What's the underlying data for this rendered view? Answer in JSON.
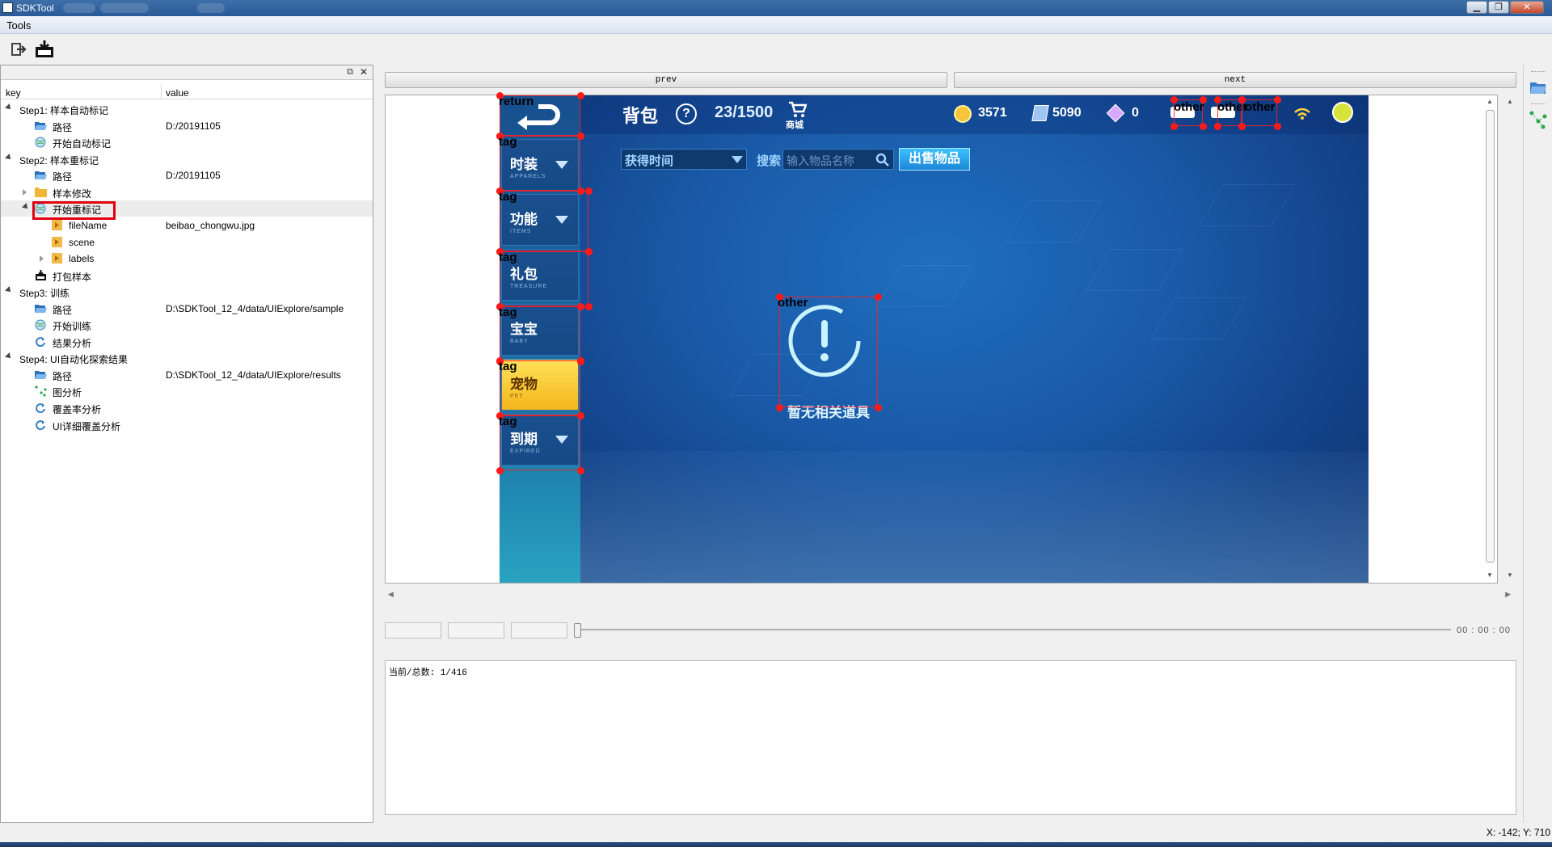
{
  "window": {
    "title": "SDKTool"
  },
  "menu": {
    "tools": "Tools"
  },
  "toolbar": {
    "icons": [
      "exit-icon",
      "save-icon"
    ]
  },
  "tree": {
    "header": {
      "key": "key",
      "value": "value"
    },
    "rows": [
      {
        "label": "Step1: 样本自动标记",
        "value": "",
        "icon": "",
        "expand": "open"
      },
      {
        "label": "路径",
        "value": "D:/20191105",
        "icon": "folder-open-icon",
        "expand": ""
      },
      {
        "label": "开始自动标记",
        "value": "",
        "icon": "globe-icon",
        "expand": ""
      },
      {
        "label": "Step2: 样本重标记",
        "value": "",
        "icon": "",
        "expand": "open"
      },
      {
        "label": "路径",
        "value": "D:/20191105",
        "icon": "folder-open-icon",
        "expand": ""
      },
      {
        "label": "样本修改",
        "value": "",
        "icon": "folder-icon",
        "expand": "closed"
      },
      {
        "label": "开始重标记",
        "value": "",
        "icon": "globe-icon",
        "expand": "open"
      },
      {
        "label": "fileName",
        "value": "beibao_chongwu.jpg",
        "icon": "play-icon",
        "expand": ""
      },
      {
        "label": "scene",
        "value": "",
        "icon": "play-icon",
        "expand": ""
      },
      {
        "label": "labels",
        "value": "",
        "icon": "play-icon",
        "expand": "closed"
      },
      {
        "label": "打包样本",
        "value": "",
        "icon": "package-icon",
        "expand": ""
      },
      {
        "label": "Step3: 训练",
        "value": "",
        "icon": "",
        "expand": "open"
      },
      {
        "label": "路径",
        "value": "D:\\SDKTool_12_4/data/UIExplore/sample",
        "icon": "folder-open-icon",
        "expand": ""
      },
      {
        "label": "开始训练",
        "value": "",
        "icon": "globe-icon",
        "expand": ""
      },
      {
        "label": "结果分析",
        "value": "",
        "icon": "refresh-icon",
        "expand": ""
      },
      {
        "label": "Step4: UI自动化探索结果",
        "value": "",
        "icon": "",
        "expand": "open"
      },
      {
        "label": "路径",
        "value": "D:\\SDKTool_12_4/data/UIExplore/results",
        "icon": "folder-open-icon",
        "expand": ""
      },
      {
        "label": "图分析",
        "value": "",
        "icon": "graph-icon",
        "expand": ""
      },
      {
        "label": "覆盖率分析",
        "value": "",
        "icon": "refresh-icon",
        "expand": ""
      },
      {
        "label": "UI详细覆盖分析",
        "value": "",
        "icon": "refresh-icon",
        "expand": ""
      }
    ]
  },
  "nav": {
    "prev": "prev",
    "next": "next"
  },
  "game": {
    "title": "背包",
    "help": "?",
    "capacity": "23/1500",
    "shop": "商城",
    "coins": "3571",
    "tickets": "5090",
    "gems": "0",
    "sort_label": "获得时间",
    "search_label": "搜索",
    "search_placeholder": "输入物品名称",
    "sell_button": "出售物品",
    "empty_message": "暂无相关道具",
    "tabs": [
      {
        "label": "时装",
        "sub": "APPARELS",
        "arrow": true
      },
      {
        "label": "功能",
        "sub": "ITEMS",
        "arrow": true
      },
      {
        "label": "礼包",
        "sub": "TREASURE",
        "arrow": false
      },
      {
        "label": "宝宝",
        "sub": "BABY",
        "arrow": false
      },
      {
        "label": "宠物",
        "sub": "PET",
        "arrow": false
      },
      {
        "label": "到期",
        "sub": "EXPIRED",
        "arrow": true
      }
    ]
  },
  "annotations": [
    {
      "label": "return"
    },
    {
      "label": "tag"
    },
    {
      "label": "tag"
    },
    {
      "label": "tag"
    },
    {
      "label": "tag"
    },
    {
      "label": "tag"
    },
    {
      "label": "tag"
    },
    {
      "label": "other"
    },
    {
      "label": "other"
    },
    {
      "label": "other"
    },
    {
      "label": "other"
    }
  ],
  "player": {
    "time": "00 : 00 : 00"
  },
  "log": {
    "text": "当前/总数: 1/416"
  },
  "status": {
    "coords": "X: -142; Y: 710"
  },
  "colors": {
    "title_bar": "#2a5a98",
    "highlight": "#e00010",
    "bbox": "#ff1a1a",
    "game_bg": "#1a5aa8",
    "active_tab": "#f3b51b"
  }
}
